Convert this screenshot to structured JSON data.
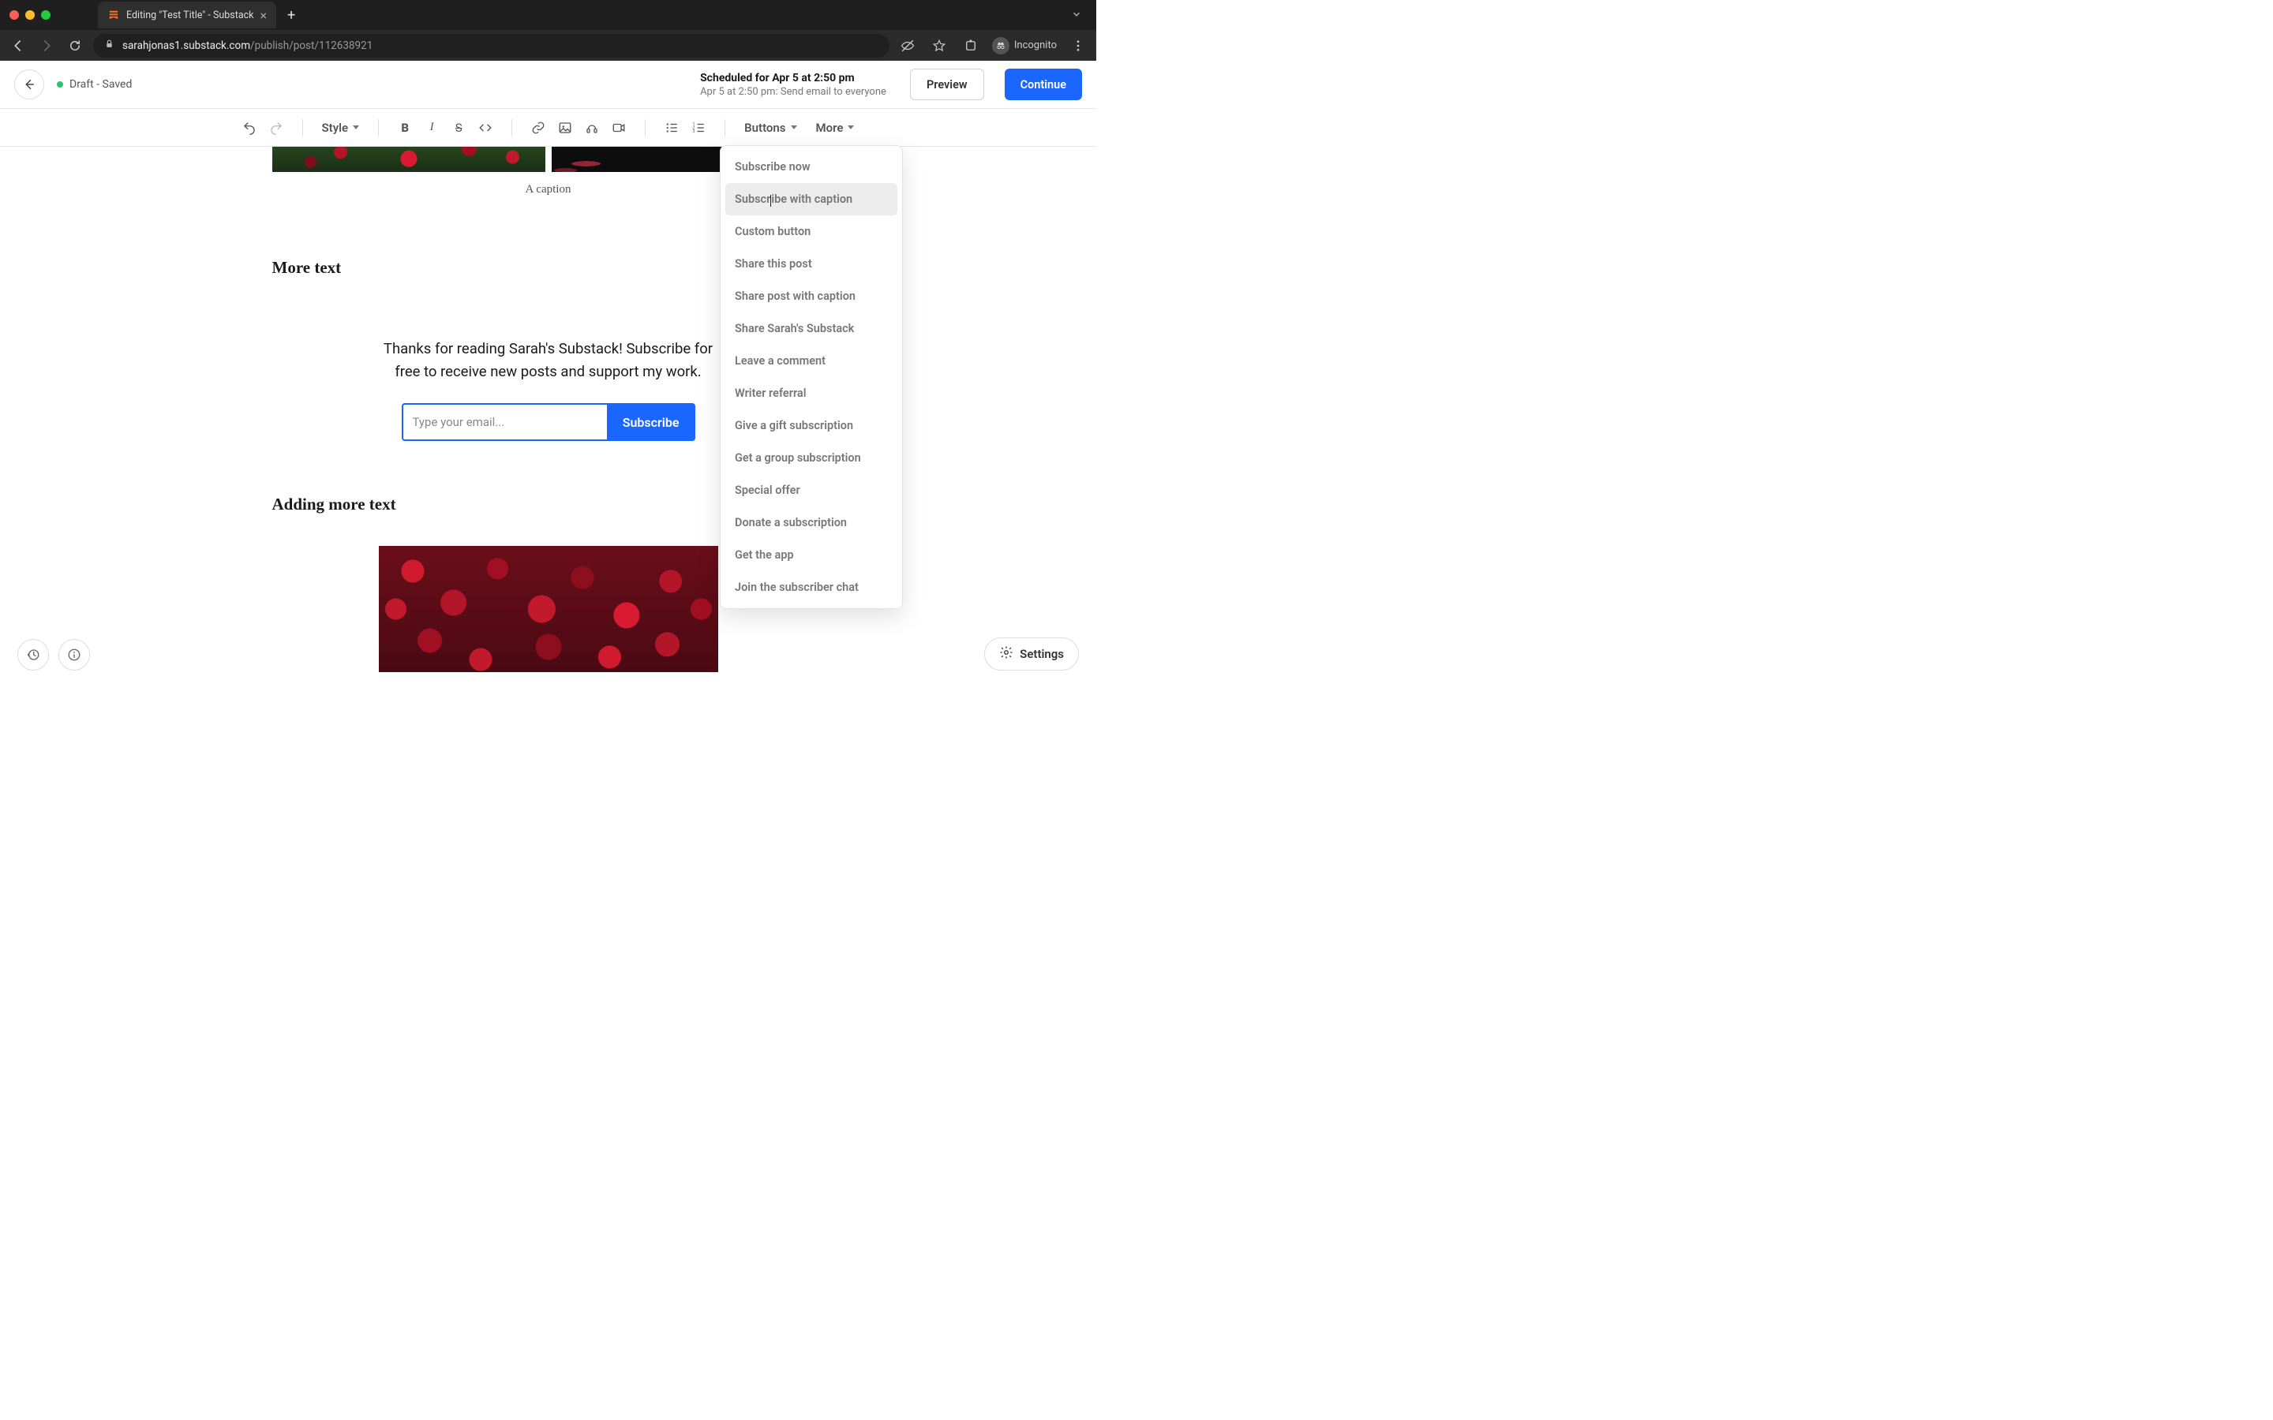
{
  "browser": {
    "tab_title": "Editing \"Test Title\" - Substack",
    "url_host": "sarahjonas1.substack.com",
    "url_path": "/publish/post/112638921",
    "incognito_label": "Incognito"
  },
  "header": {
    "draft_status": "Draft - Saved",
    "schedule_title": "Scheduled for Apr 5 at 2:50 pm",
    "schedule_sub": "Apr 5 at 2:50 pm: Send email to everyone",
    "preview_label": "Preview",
    "continue_label": "Continue"
  },
  "toolbar": {
    "style_label": "Style",
    "buttons_label": "Buttons",
    "more_label": "More"
  },
  "dropdown": {
    "items": [
      "Subscribe now",
      "Subscribe with caption",
      "Custom button",
      "Share this post",
      "Share post with caption",
      "Share Sarah's Substack",
      "Leave a comment",
      "Writer referral",
      "Give a gift subscription",
      "Get a group subscription",
      "Special offer",
      "Donate a subscription",
      "Get the app",
      "Join the subscriber chat"
    ],
    "hovered_index": 1
  },
  "editor": {
    "caption": "A caption",
    "heading1": "More text",
    "subscribe_text": "Thanks for reading Sarah's Substack! Subscribe for free to receive new posts and support my work.",
    "email_placeholder": "Type your email...",
    "subscribe_btn": "Subscribe",
    "heading2": "Adding more text"
  },
  "footer": {
    "settings_label": "Settings"
  }
}
